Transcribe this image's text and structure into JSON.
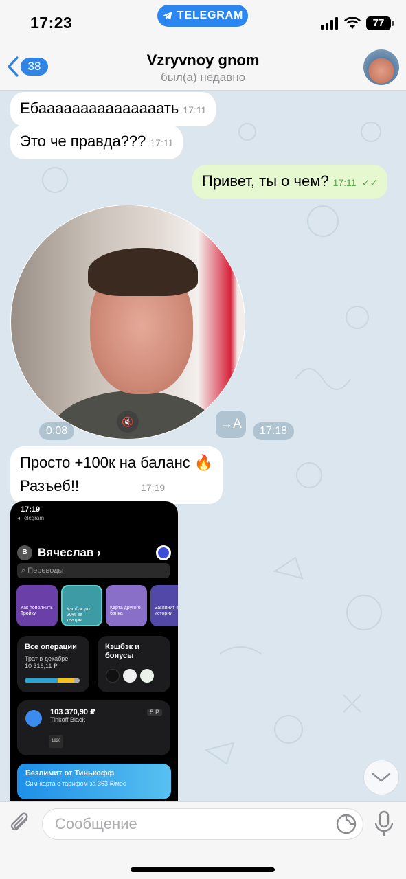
{
  "status_bar": {
    "time": "17:23",
    "app_pill": "TELEGRAM",
    "battery": "77"
  },
  "header": {
    "back_count": "38",
    "title": "Vzryvnoy gnom",
    "subtitle": "был(а) недавно"
  },
  "messages": [
    {
      "direction": "in",
      "text": "Ебааааааааааааааать",
      "time": "17:11"
    },
    {
      "direction": "in",
      "text": "Это че правда???",
      "time": "17:11"
    },
    {
      "direction": "out",
      "text": "Привет, ты о чем?",
      "time": "17:11",
      "read_marks": "✓✓"
    },
    {
      "direction": "in",
      "type": "video_note",
      "duration": "0:08",
      "time": "17:18",
      "translate_label": "→A"
    },
    {
      "direction": "in",
      "text_line1": "Просто +100к на баланс 🔥",
      "text_line2": "Разъеб!!",
      "time": "17:19"
    }
  ],
  "screenshot": {
    "time": "17:19",
    "back_label": "◂ Telegram",
    "user_initial": "В",
    "user_name": "Вячеслав ›",
    "search_placeholder": "Переводы",
    "stories": [
      {
        "label": "Как пополнить Тройку"
      },
      {
        "label": "Кэшбэк до 20% за театры"
      },
      {
        "label": "Карта другого банка"
      },
      {
        "label": "Заглянит в истории"
      }
    ],
    "ops_title": "Все операции",
    "ops_sub": "Трат в декабре",
    "ops_amount": "10 316,11 ₽",
    "cashback_title": "Кэшбэк и бонусы",
    "balance": "103 370,90 ₽",
    "card_name": "Tinkoff Black",
    "badge": "5 P",
    "card_num": "1920",
    "promo_title": "Безлимит от Тинькофф",
    "promo_sub": "Сим-карта с тарифом за 363 ₽/мес"
  },
  "composer": {
    "placeholder": "Сообщение"
  },
  "colors": {
    "accent": "#2f84e4",
    "chat_bg": "#dbe6ee",
    "outgoing_bubble": "#e6f8cf"
  }
}
